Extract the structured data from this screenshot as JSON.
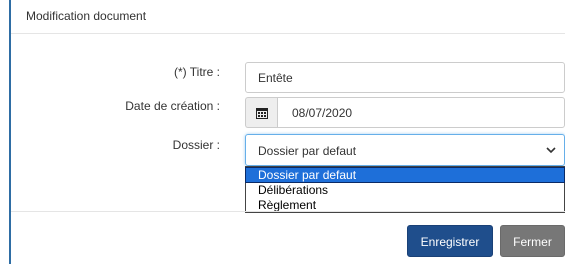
{
  "modal": {
    "title": "Modification document"
  },
  "form": {
    "titre_label": "(*) Titre :",
    "titre_value": "Entête",
    "date_label": "Date de création :",
    "date_value": "08/07/2020",
    "dossier_label": "Dossier :",
    "dossier_selected": "Dossier par defaut",
    "dossier_options": [
      "Dossier par defaut",
      "Délibérations",
      "Règlement"
    ]
  },
  "buttons": {
    "save_label": "Enregistrer",
    "close_label": "Fermer"
  },
  "icons": {
    "calendar": "calendar-icon",
    "chevron": "chevron-down-icon"
  },
  "colors": {
    "primary": "#1f4e8c",
    "secondary": "#777777",
    "selected_option": "#1e6fd9"
  }
}
